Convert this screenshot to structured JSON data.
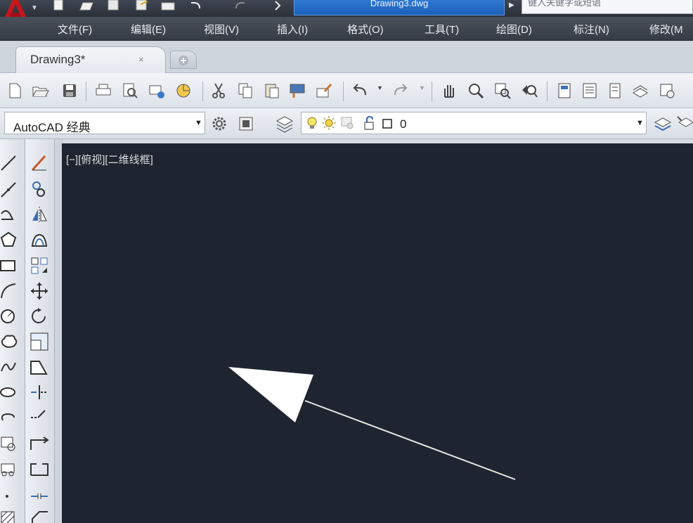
{
  "title_bar": {
    "document_title": "Drawing3.dwg",
    "search_placeholder": "键入关键字或短语"
  },
  "menu": {
    "items": [
      "文件(F)",
      "编辑(E)",
      "视图(V)",
      "插入(I)",
      "格式(O)",
      "工具(T)",
      "绘图(D)",
      "标注(N)",
      "修改(M"
    ]
  },
  "tabs": {
    "active_label": "Drawing3*",
    "close_glyph": "×"
  },
  "workspace": {
    "value": "AutoCAD 经典"
  },
  "layer": {
    "value": "0"
  },
  "canvas": {
    "viewport_label": "[−][俯视][二维线框]",
    "background": "#1f2530"
  },
  "colors": {
    "logo_red": "#c8161d",
    "title_blue": "#1f66c2"
  }
}
